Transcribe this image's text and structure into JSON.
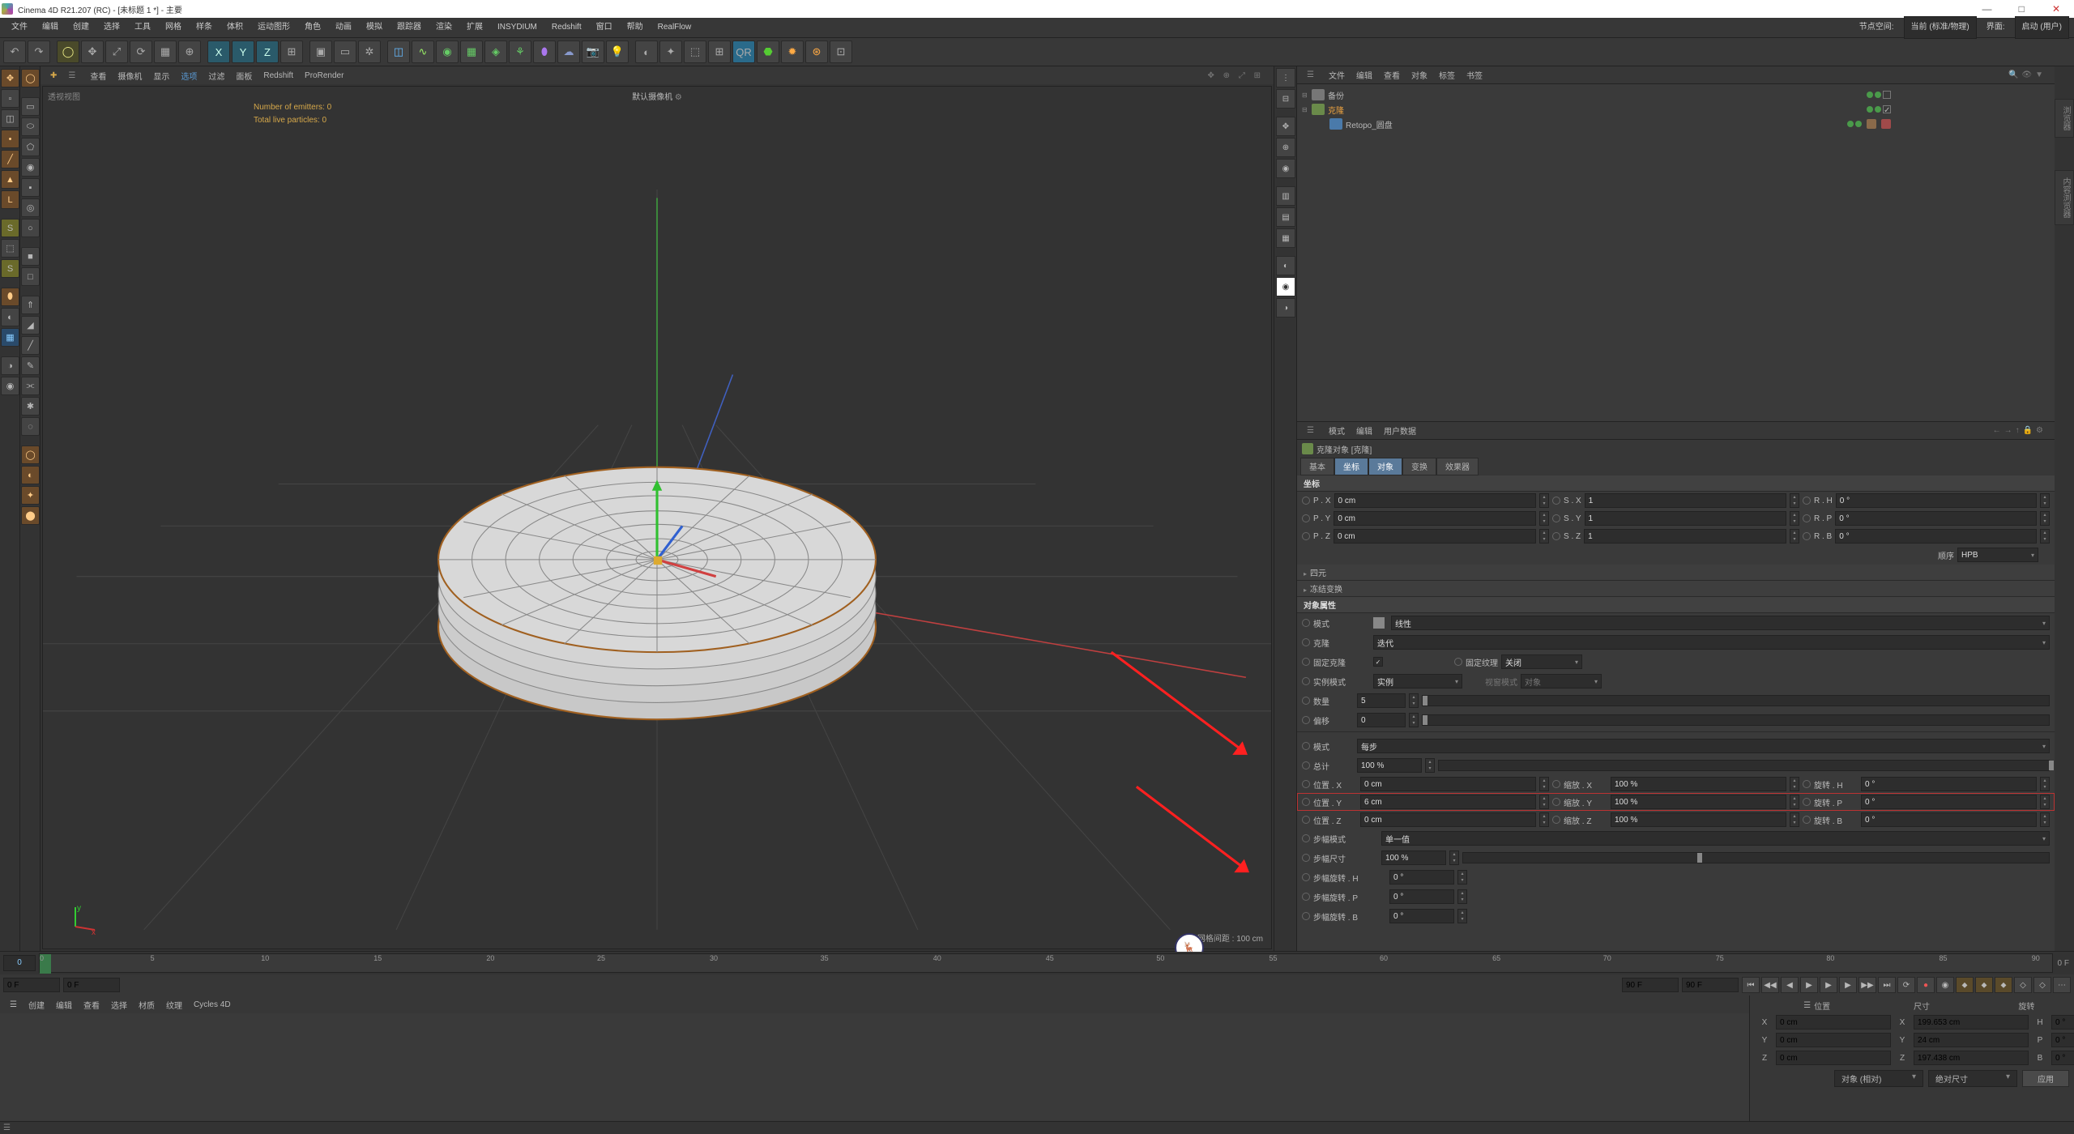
{
  "title": "Cinema 4D R21.207 (RC) - [未标题 1 *] - 主要",
  "menubar": [
    "文件",
    "编辑",
    "创建",
    "选择",
    "工具",
    "网格",
    "样条",
    "体积",
    "运动图形",
    "角色",
    "动画",
    "模拟",
    "跟踪器",
    "渲染",
    "扩展",
    "INSYDIUM",
    "Redshift",
    "窗口",
    "帮助",
    "RealFlow"
  ],
  "menubar_right": {
    "node_space": "节点空间:",
    "node_val": "当前 (标准/物理)",
    "layout": "界面:",
    "layout_val": "启动 (用户)"
  },
  "vp_menu": [
    "查看",
    "摄像机",
    "显示",
    "选项",
    "过滤",
    "面板",
    "Redshift",
    "ProRender"
  ],
  "vp": {
    "label": "透视视图",
    "camera": "默认摄像机",
    "stats1": "Number of emitters: 0",
    "stats2": "Total live particles: 0",
    "grid": "网格间距 : 100 cm"
  },
  "obj_menu": [
    "文件",
    "编辑",
    "查看",
    "对象",
    "标签",
    "书签"
  ],
  "obj_tree": {
    "backup": "备份",
    "clone": "克隆",
    "retopo": "Retopo_圆盘"
  },
  "attr_menu": [
    "模式",
    "编辑",
    "用户数据"
  ],
  "attr_title": "克隆对象 [克隆]",
  "tabs": [
    "基本",
    "坐标",
    "对象",
    "变换",
    "效果器"
  ],
  "coord_section": "坐标",
  "coord": {
    "px": {
      "l": "P . X",
      "v": "0 cm"
    },
    "sx": {
      "l": "S . X",
      "v": "1"
    },
    "rh": {
      "l": "R . H",
      "v": "0 °"
    },
    "py": {
      "l": "P . Y",
      "v": "0 cm"
    },
    "sy": {
      "l": "S . Y",
      "v": "1"
    },
    "rp": {
      "l": "R . P",
      "v": "0 °"
    },
    "pz": {
      "l": "P . Z",
      "v": "0 cm"
    },
    "sz": {
      "l": "S . Z",
      "v": "1"
    },
    "rb": {
      "l": "R . B",
      "v": "0 °"
    },
    "order_l": "顺序",
    "order_v": "HPB"
  },
  "sub_quat": "四元",
  "sub_freeze": "冻结变换",
  "objprop_section": "对象属性",
  "objprop": {
    "mode_l": "模式",
    "mode_v": "线性",
    "clone_l": "克隆",
    "clone_v": "迭代",
    "fixclone_l": "固定克隆",
    "fixtex_l": "固定纹理",
    "fixtex_v": "关闭",
    "inst_l": "实例模式",
    "inst_v": "实例",
    "view_l": "视窗模式",
    "view_v": "对象",
    "count_l": "数量",
    "count_v": "5",
    "offset_l": "偏移",
    "offset_v": "0",
    "mode2_l": "模式",
    "mode2_v": "每步",
    "total_l": "总计",
    "total_v": "100 %",
    "posx_l": "位置 . X",
    "posx_v": "0 cm",
    "sclx_l": "缩放 . X",
    "sclx_v": "100 %",
    "rotx_l": "旋转 . H",
    "rotx_v": "0 °",
    "posy_l": "位置 . Y",
    "posy_v": "6 cm",
    "scly_l": "缩放 . Y",
    "scly_v": "100 %",
    "roty_l": "旋转 . P",
    "roty_v": "0 °",
    "posz_l": "位置 . Z",
    "posz_v": "0 cm",
    "sclz_l": "缩放 . Z",
    "sclz_v": "100 %",
    "rotz_l": "旋转 . B",
    "rotz_v": "0 °",
    "stepmode_l": "步幅模式",
    "stepmode_v": "单一值",
    "stepsize_l": "步幅尺寸",
    "stepsize_v": "100 %",
    "steph_l": "步幅旋转 . H",
    "steph_v": "0 °",
    "stepp_l": "步幅旋转 . P",
    "stepp_v": "0 °",
    "stepb_l": "步幅旋转 . B",
    "stepb_v": "0 °"
  },
  "timeline": {
    "start": "0",
    "end": "90 F",
    "end2": "90 F",
    "cur": "0 F",
    "cur2": "0 F",
    "endlbl": "0 F",
    "ticks": [
      0,
      5,
      10,
      15,
      20,
      25,
      30,
      35,
      40,
      45,
      50,
      55,
      60,
      65,
      70,
      75,
      80,
      85,
      90
    ]
  },
  "mat_menu": [
    "创建",
    "编辑",
    "查看",
    "选择",
    "材质",
    "纹理",
    "Cycles 4D"
  ],
  "coord_panel": {
    "h1": "位置",
    "h2": "尺寸",
    "h3": "旋转",
    "x": "X",
    "xv": "0 cm",
    "sx": "X",
    "sxv": "199.653 cm",
    "rh": "H",
    "rhv": "0 °",
    "y": "Y",
    "yv": "0 cm",
    "sy": "Y",
    "syv": "24 cm",
    "rp": "P",
    "rpv": "0 °",
    "z": "Z",
    "zv": "0 cm",
    "sz": "Z",
    "szv": "197.438 cm",
    "rb": "B",
    "rbv": "0 °",
    "sel1": "对象 (相对)",
    "sel2": "绝对尺寸",
    "apply": "应用"
  },
  "sidetabs": [
    "浏览器",
    "内容浏览器"
  ]
}
